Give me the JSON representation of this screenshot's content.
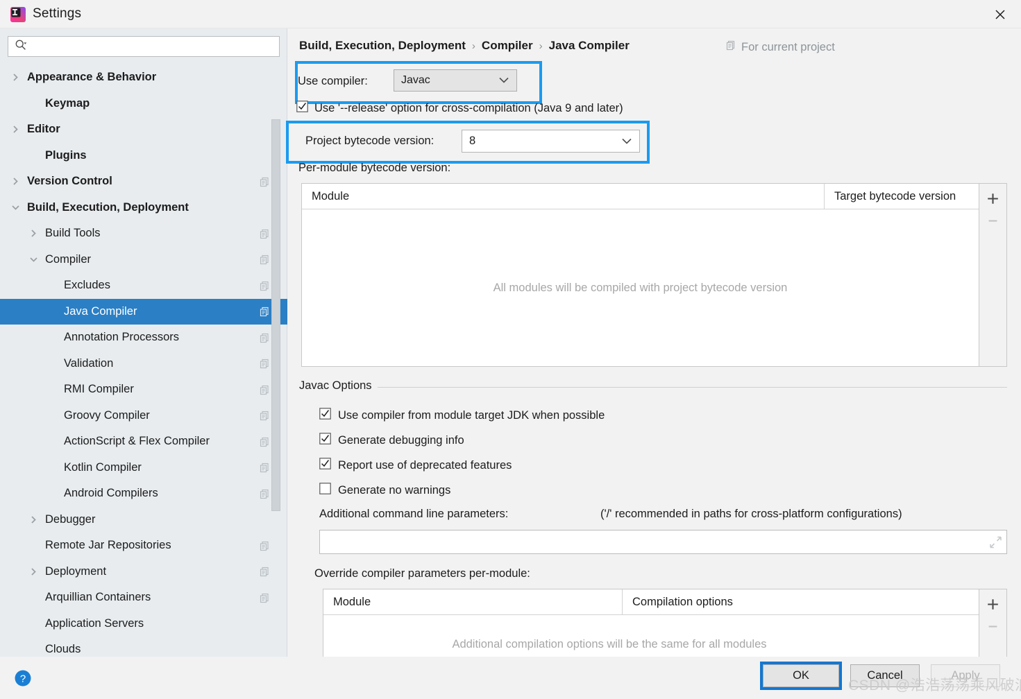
{
  "window": {
    "title": "Settings",
    "app_icon": "intellij-idea-icon",
    "close_icon": "close-icon"
  },
  "search": {
    "value": "",
    "placeholder": "",
    "icon": "search-icon"
  },
  "sidebar": {
    "items": [
      {
        "label": "Appearance & Behavior",
        "indent": 14,
        "arrow": "chevron-right",
        "bold": true,
        "copy": false,
        "selected": false
      },
      {
        "label": "Keymap",
        "indent": 40,
        "arrow": "none",
        "bold": true,
        "copy": false,
        "selected": false
      },
      {
        "label": "Editor",
        "indent": 14,
        "arrow": "chevron-right",
        "bold": true,
        "copy": false,
        "selected": false
      },
      {
        "label": "Plugins",
        "indent": 40,
        "arrow": "none",
        "bold": true,
        "copy": false,
        "selected": false
      },
      {
        "label": "Version Control",
        "indent": 14,
        "arrow": "chevron-right",
        "bold": true,
        "copy": true,
        "selected": false
      },
      {
        "label": "Build, Execution, Deployment",
        "indent": 14,
        "arrow": "chevron-down",
        "bold": true,
        "copy": false,
        "selected": false
      },
      {
        "label": "Build Tools",
        "indent": 40,
        "arrow": "chevron-right",
        "bold": false,
        "copy": true,
        "selected": false
      },
      {
        "label": "Compiler",
        "indent": 40,
        "arrow": "chevron-down",
        "bold": false,
        "copy": true,
        "selected": false
      },
      {
        "label": "Excludes",
        "indent": 67,
        "arrow": "none",
        "bold": false,
        "copy": true,
        "selected": false
      },
      {
        "label": "Java Compiler",
        "indent": 67,
        "arrow": "none",
        "bold": false,
        "copy": true,
        "selected": true
      },
      {
        "label": "Annotation Processors",
        "indent": 67,
        "arrow": "none",
        "bold": false,
        "copy": true,
        "selected": false
      },
      {
        "label": "Validation",
        "indent": 67,
        "arrow": "none",
        "bold": false,
        "copy": true,
        "selected": false
      },
      {
        "label": "RMI Compiler",
        "indent": 67,
        "arrow": "none",
        "bold": false,
        "copy": true,
        "selected": false
      },
      {
        "label": "Groovy Compiler",
        "indent": 67,
        "arrow": "none",
        "bold": false,
        "copy": true,
        "selected": false
      },
      {
        "label": "ActionScript & Flex Compiler",
        "indent": 67,
        "arrow": "none",
        "bold": false,
        "copy": true,
        "selected": false
      },
      {
        "label": "Kotlin Compiler",
        "indent": 67,
        "arrow": "none",
        "bold": false,
        "copy": true,
        "selected": false
      },
      {
        "label": "Android Compilers",
        "indent": 67,
        "arrow": "none",
        "bold": false,
        "copy": true,
        "selected": false
      },
      {
        "label": "Debugger",
        "indent": 40,
        "arrow": "chevron-right",
        "bold": false,
        "copy": false,
        "selected": false
      },
      {
        "label": "Remote Jar Repositories",
        "indent": 40,
        "arrow": "none",
        "bold": false,
        "copy": true,
        "selected": false
      },
      {
        "label": "Deployment",
        "indent": 40,
        "arrow": "chevron-right",
        "bold": false,
        "copy": true,
        "selected": false
      },
      {
        "label": "Arquillian Containers",
        "indent": 40,
        "arrow": "none",
        "bold": false,
        "copy": true,
        "selected": false
      },
      {
        "label": "Application Servers",
        "indent": 40,
        "arrow": "none",
        "bold": false,
        "copy": false,
        "selected": false
      },
      {
        "label": "Clouds",
        "indent": 40,
        "arrow": "none",
        "bold": false,
        "copy": false,
        "selected": false
      }
    ]
  },
  "main": {
    "breadcrumb": {
      "parts": [
        "Build, Execution, Deployment",
        "Compiler",
        "Java Compiler"
      ],
      "separator": "›"
    },
    "for_current_project": {
      "label": "For current project",
      "icon": "copy-icon"
    },
    "use_compiler": {
      "label": "Use compiler:",
      "value": "Javac",
      "chevron_icon": "chevron-down-icon"
    },
    "release_option": {
      "label": "Use '--release' option for cross-compilation (Java 9 and later)",
      "checked": true
    },
    "project_bytecode": {
      "label": "Project bytecode version:",
      "value": "8",
      "chevron_icon": "chevron-down-icon"
    },
    "per_module_label": "Per-module bytecode version:",
    "per_module_table": {
      "columns": [
        "Module",
        "Target bytecode version"
      ],
      "rows": [],
      "empty_text": "All modules will be compiled with project bytecode version",
      "add_button": "+",
      "remove_button": "–"
    },
    "javac_options": {
      "group_title": "Javac Options",
      "checkboxes": [
        {
          "label": "Use compiler from module target JDK when possible",
          "checked": true
        },
        {
          "label": "Generate debugging info",
          "checked": true
        },
        {
          "label": "Report use of deprecated features",
          "checked": true
        },
        {
          "label": "Generate no warnings",
          "checked": false
        }
      ],
      "additional_params_label": "Additional command line parameters:",
      "additional_params_hint": "('/' recommended in paths for cross-platform configurations)",
      "additional_params_value": "",
      "expand_icon": "expand-icon"
    },
    "override_label": "Override compiler parameters per-module:",
    "override_table": {
      "columns": [
        "Module",
        "Compilation options"
      ],
      "rows": [],
      "empty_text": "Additional compilation options will be the same for all modules",
      "add_button": "+",
      "remove_button": "–"
    }
  },
  "bottom": {
    "help_icon": "help-icon",
    "ok_label": "OK",
    "cancel_label": "Cancel",
    "apply_label": "Apply"
  },
  "watermark": {
    "text": "CSDN @浩浩荡荡乘风破浪"
  },
  "colors": {
    "accent_blue": "#1a9bef",
    "selection_blue": "#2b7fc4",
    "focus_blue": "#1477d1",
    "sidebar_bg": "#e8ecef",
    "panel_bg": "#f2f2f2"
  }
}
